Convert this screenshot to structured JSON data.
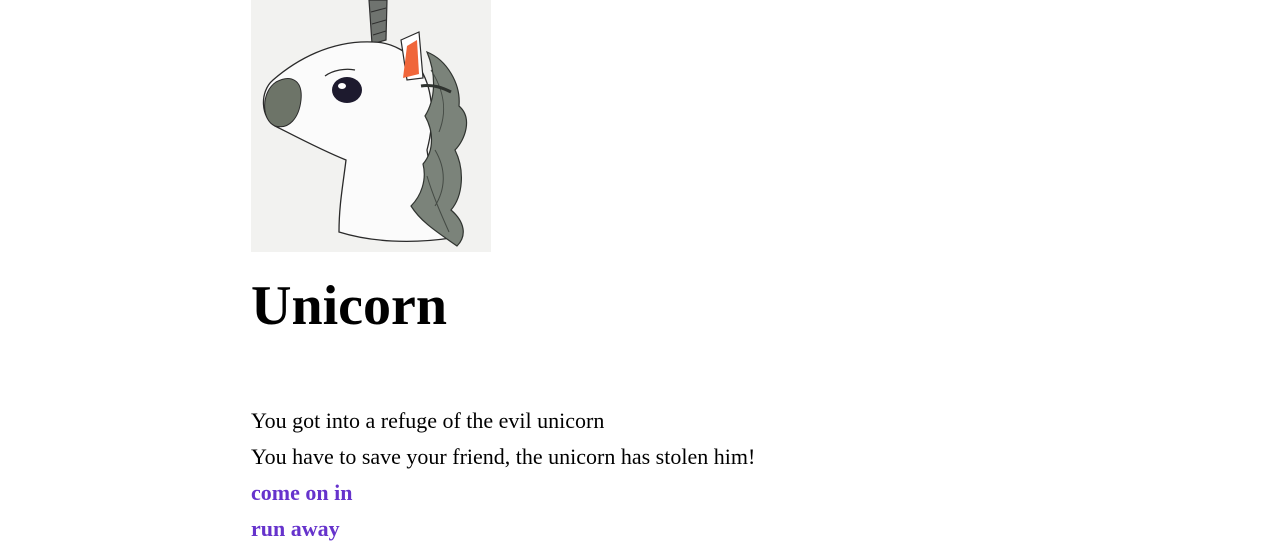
{
  "scene": {
    "title": "Unicorn",
    "story_lines": [
      "You got into a refuge of the evil unicorn",
      "You have to save your friend, the unicorn has stolen him!"
    ],
    "choices": [
      "come on in",
      "run away"
    ],
    "choice_color": "#6633cc"
  }
}
